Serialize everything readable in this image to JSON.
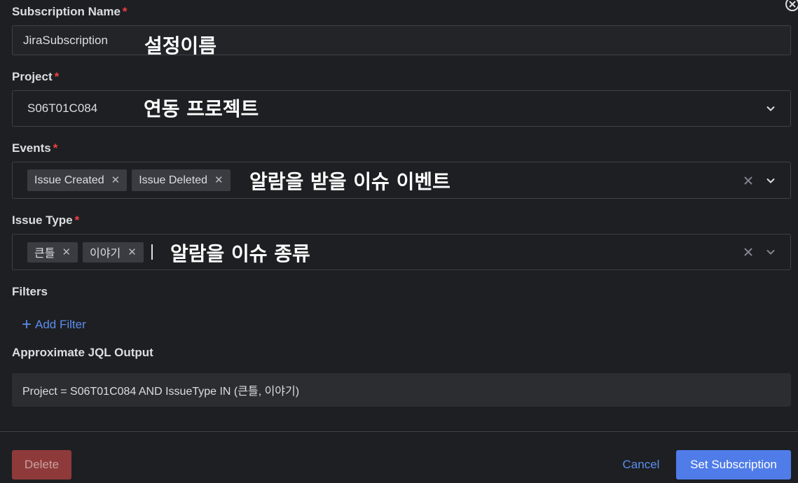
{
  "subscription_name": {
    "label": "Subscription Name",
    "required": "*",
    "value": "JiraSubscription",
    "annotation": "설정이름"
  },
  "project": {
    "label": "Project",
    "required": "*",
    "value": "S06T01C084",
    "annotation": "연동 프로젝트"
  },
  "events": {
    "label": "Events",
    "required": "*",
    "chips": [
      "Issue Created",
      "Issue Deleted"
    ],
    "annotation": "알람을 받을 이슈 이벤트"
  },
  "issue_type": {
    "label": "Issue Type",
    "required": "*",
    "chips": [
      "큰틀",
      "이야기"
    ],
    "annotation": "알람을 이슈 종류"
  },
  "filters": {
    "label": "Filters",
    "add_label": "Add Filter"
  },
  "jql": {
    "label": "Approximate JQL Output",
    "value": "Project = S06T01C084 AND IssueType IN (큰틀, 이야기)"
  },
  "buttons": {
    "delete": "Delete",
    "cancel": "Cancel",
    "submit": "Set Subscription"
  },
  "colors": {
    "background": "#1e1f22",
    "accent": "#4f7ce8",
    "link": "#5b8def",
    "required": "#f23f42",
    "danger": "#8f3a3a"
  }
}
